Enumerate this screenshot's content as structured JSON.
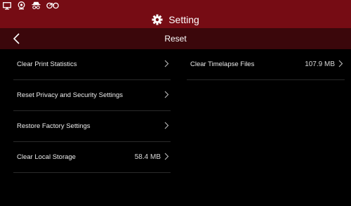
{
  "status_icons": [
    "monitor-icon",
    "webcam-icon",
    "incognito-icon",
    "cycle-icon"
  ],
  "header": {
    "title": "Setting",
    "icon": "gear-icon"
  },
  "nav": {
    "title": "Reset",
    "back_icon": "chevron-left-icon"
  },
  "left_items": [
    {
      "label": "Clear Print Statistics",
      "value": ""
    },
    {
      "label": "Reset Privacy and Security Settings",
      "value": ""
    },
    {
      "label": "Restore Factory Settings",
      "value": ""
    },
    {
      "label": "Clear Local Storage",
      "value": "58.4 MB"
    }
  ],
  "right_items": [
    {
      "label": "Clear Timelapse Files",
      "value": "107.9 MB"
    }
  ],
  "colors": {
    "header_bg": "#760c14",
    "nav_bg": "#3b070b",
    "page_bg": "#000000"
  }
}
